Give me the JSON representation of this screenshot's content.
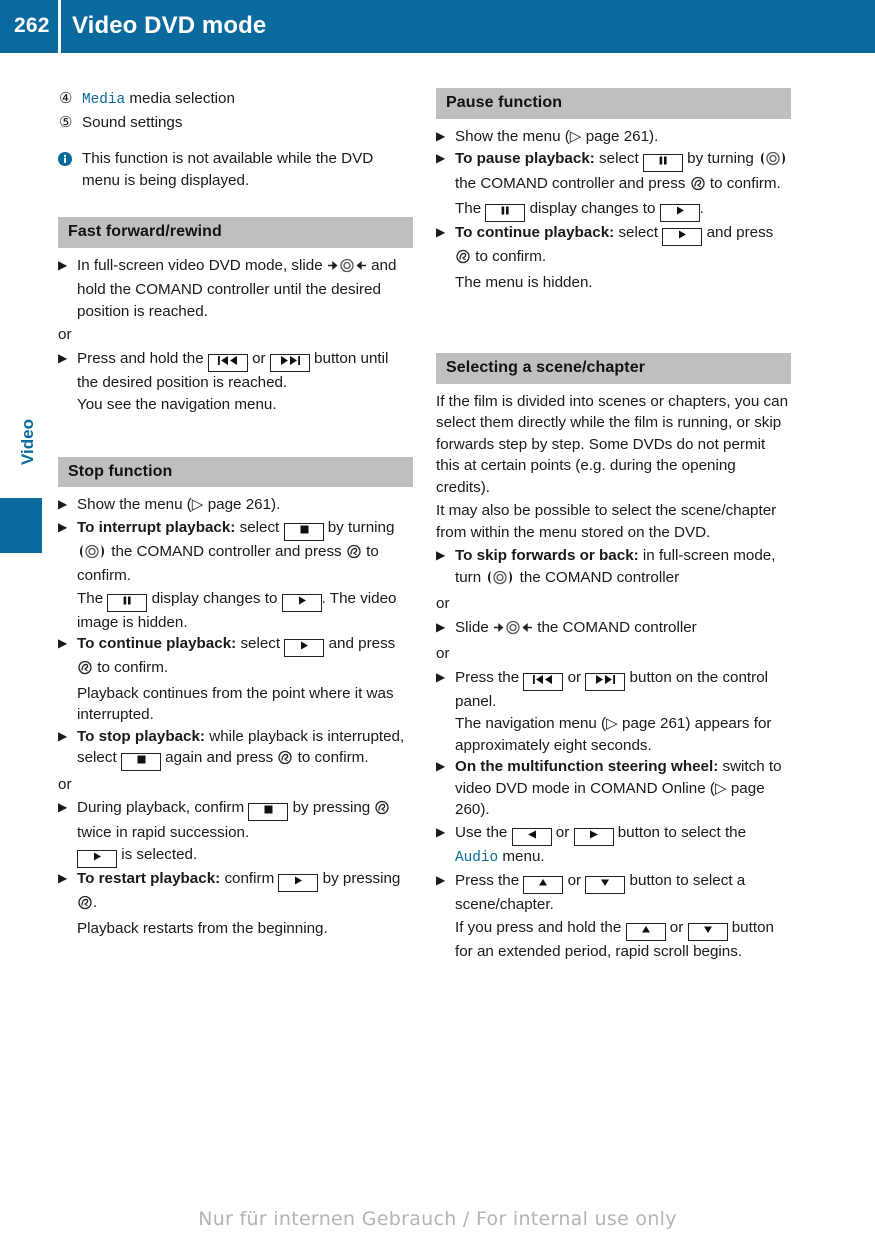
{
  "header": {
    "page_number": "262",
    "title": "Video DVD mode",
    "background_color": "#0a6a9e"
  },
  "side_tab": {
    "label": "Video",
    "color": "#0a6a9e"
  },
  "left_column": {
    "legend_items": [
      {
        "number": "④",
        "mono_term": "Media",
        "text": " media selection"
      },
      {
        "number": "⑤",
        "mono_term": "",
        "text": "Sound settings"
      }
    ],
    "note": {
      "icon": "info-icon",
      "text": "This function is not available while the DVD menu is being displayed."
    },
    "sections": [
      {
        "heading": "Fast forward/rewind",
        "blocks": [
          {
            "type": "item",
            "text_1": "In full-screen video DVD mode, slide ",
            "icon": "slide-controller-icon",
            "text_2": " and hold the COMAND controller until the desired position is reached."
          },
          {
            "type": "or",
            "text": "or"
          },
          {
            "type": "item",
            "text_1": "Press and hold the ",
            "icon_a": "rewind-button-icon",
            "mid": " or ",
            "icon_b": "fast-forward-button-icon",
            "text_2": " button until the desired position is reached."
          },
          {
            "type": "plain",
            "text": "You see the navigation menu."
          }
        ]
      },
      {
        "heading": "Stop function",
        "blocks": [
          {
            "type": "item",
            "text_1": "Show the menu (▷ page 261)."
          },
          {
            "type": "item_bold",
            "bold": "To interrupt playback:",
            "text_1": " select ",
            "icon_a": "stop-button-icon",
            "text_2": " by turning ",
            "icon_b": "turn-controller-icon",
            "text_3": " the COMAND controller and press ",
            "icon_c": "press-controller-icon",
            "text_4": " to confirm."
          },
          {
            "type": "plain",
            "text_1": "The ",
            "icon_a": "pause-button-icon",
            "text_2": " display changes to ",
            "icon_b": "play-button-icon",
            "text_3": ". The video image is hidden."
          },
          {
            "type": "item_bold",
            "bold": "To continue playback:",
            "text_1": " select ",
            "icon_a": "play-button-icon",
            "text_2": " and press ",
            "icon_b": "press-controller-icon",
            "text_3": " to confirm."
          },
          {
            "type": "plain",
            "text": "Playback continues from the point where it was interrupted."
          },
          {
            "type": "item_bold",
            "bold": "To stop playback:",
            "text_1": " while playback is interrupted, select ",
            "icon_a": "stop-button-icon",
            "text_2": " again and press ",
            "icon_b": "press-controller-icon",
            "text_3": " to confirm."
          },
          {
            "type": "or",
            "text": "or"
          },
          {
            "type": "item",
            "text_1": "During playback, confirm ",
            "icon_a": "stop-button-icon",
            "text_2": " by pressing ",
            "icon_b": "press-controller-icon",
            "text_3": " twice in rapid succession."
          },
          {
            "type": "plain",
            "icon_a": "play-button-icon",
            "text_2": " is selected."
          },
          {
            "type": "item_bold",
            "bold": "To restart playback:",
            "text_1": " confirm ",
            "icon_a": "play-button-icon",
            "text_2": " by pressing ",
            "icon_b": "press-controller-icon",
            "text_3": "."
          },
          {
            "type": "plain",
            "text": "Playback restarts from the beginning."
          }
        ]
      }
    ]
  },
  "right_column": {
    "sections": [
      {
        "heading": "Pause function",
        "blocks": [
          {
            "type": "item",
            "text_1": "Show the menu (▷ page 261)."
          },
          {
            "type": "item_bold",
            "bold": "To pause playback:",
            "text_1": " select ",
            "icon_a": "pause-button-icon",
            "text_2": " by turning ",
            "icon_b": "turn-controller-icon",
            "text_3": " the COMAND controller and press ",
            "icon_c": "press-controller-icon",
            "text_4": " to confirm."
          },
          {
            "type": "plain",
            "text_1": "The ",
            "icon_a": "pause-button-icon",
            "text_2": " display changes to ",
            "icon_b": "play-button-icon",
            "text_3": "."
          },
          {
            "type": "item_bold",
            "bold": "To continue playback:",
            "text_1": " select ",
            "icon_a": "play-button-icon",
            "text_2": " and press ",
            "icon_b": "press-controller-icon",
            "text_3": " to confirm."
          },
          {
            "type": "plain",
            "text": "The menu is hidden."
          }
        ]
      },
      {
        "heading": "Selecting a scene/chapter",
        "blocks": [
          {
            "type": "para",
            "text": "If the film is divided into scenes or chapters, you can select them directly while the film is running, or skip forwards step by step. Some DVDs do not permit this at certain points (e.g. during the opening credits)."
          },
          {
            "type": "para",
            "text": "It may also be possible to select the scene/chapter from within the menu stored on the DVD."
          },
          {
            "type": "item_bold",
            "bold": "To skip forwards or back:",
            "text_1": " in full-screen mode, turn ",
            "icon_b": "turn-controller-icon",
            "text_2": " the COMAND controller"
          },
          {
            "type": "or",
            "text": "or"
          },
          {
            "type": "item",
            "text_1": "Slide ",
            "icon": "slide-controller-icon",
            "text_2": " the COMAND controller"
          },
          {
            "type": "or",
            "text": "or"
          },
          {
            "type": "item",
            "text_1": "Press the ",
            "icon_a": "rewind-button-icon",
            "mid": " or ",
            "icon_b": "fast-forward-button-icon",
            "text_2": " button on the control panel."
          },
          {
            "type": "plain",
            "text": "The navigation menu (▷ page 261) appears for approximately eight seconds."
          },
          {
            "type": "item_bold",
            "bold": "On the multifunction steering wheel:",
            "text_1": " switch to video DVD mode in COMAND Online (▷ page 260)."
          },
          {
            "type": "item",
            "text_1": "Use the ",
            "icon_a": "left-arrow-button-icon",
            "mid": " or ",
            "icon_b": "right-arrow-button-icon",
            "text_2": " button to select the ",
            "mono_term": "Audio",
            "text_3": " menu."
          },
          {
            "type": "item",
            "text_1": "Press the ",
            "icon_a": "up-arrow-button-icon",
            "mid": " or ",
            "icon_b": "down-arrow-button-icon",
            "text_2": " button to select a scene/chapter."
          },
          {
            "type": "plain",
            "text_1": "If you press and hold the ",
            "icon_a": "up-arrow-button-icon",
            "mid": " or ",
            "icon_b": "down-arrow-button-icon",
            "text_2": " button for an extended period, rapid scroll begins."
          }
        ]
      }
    ]
  },
  "footer": {
    "watermark": "Nur für internen Gebrauch / For internal use only"
  }
}
